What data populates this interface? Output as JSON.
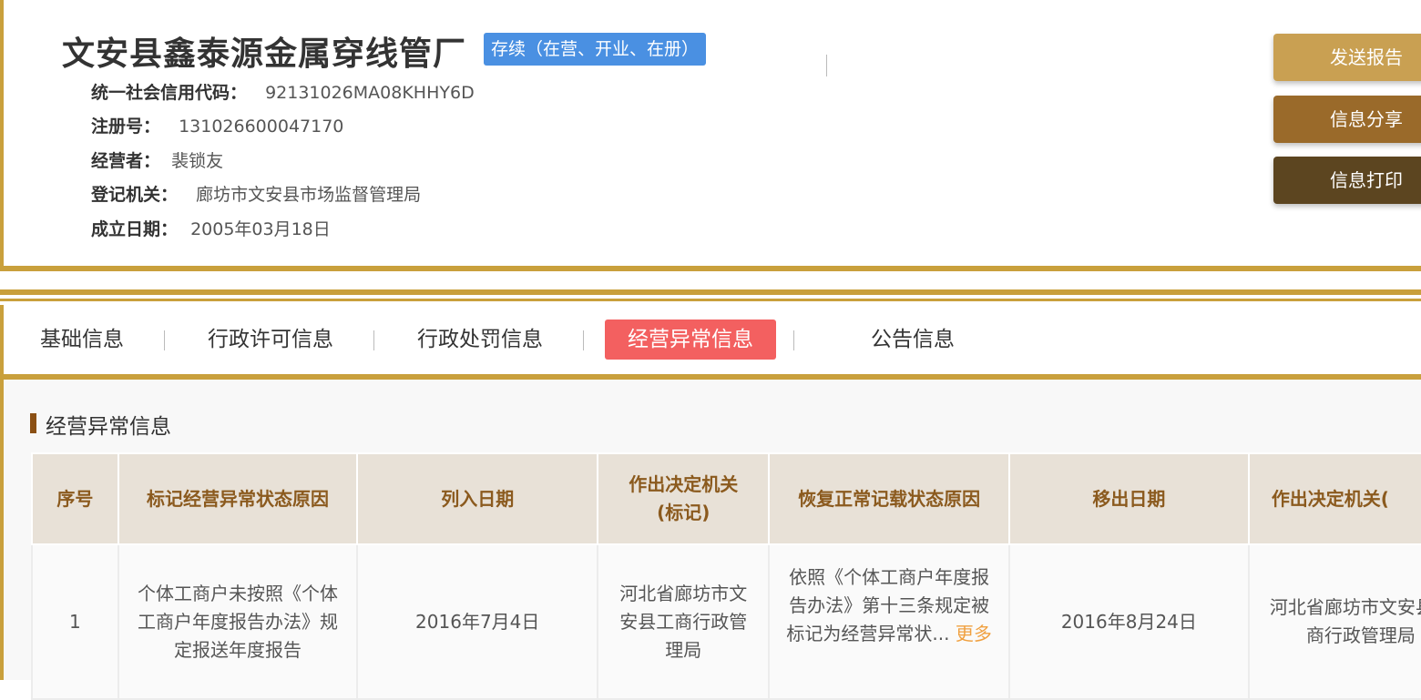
{
  "company": {
    "name": "文安县鑫泰源金属穿线管厂",
    "status": "存续（在营、开业、在册）"
  },
  "info": [
    {
      "label": "统一社会信用代码：",
      "value": "92131026MA08KHHY6D"
    },
    {
      "label": "注册号：",
      "value": "131026600047170"
    },
    {
      "label": "经营者：",
      "value": "裴锁友"
    },
    {
      "label": "登记机关：",
      "value": "廊坊市文安县市场监督管理局"
    },
    {
      "label": "成立日期：",
      "value": "2005年03月18日"
    }
  ],
  "actions": {
    "report": "发送报告",
    "share": "信息分享",
    "print": "信息打印"
  },
  "tabs": [
    "基础信息",
    "行政许可信息",
    "行政处罚信息",
    "经营异常信息",
    "公告信息"
  ],
  "section": {
    "title": "经营异常信息"
  },
  "table": {
    "headers": [
      "序号",
      "标记经营异常状态原因",
      "列入日期",
      "作出决定机关(标记)",
      "恢复正常记载状态原因",
      "移出日期",
      "作出决定机关(移出)"
    ],
    "header_lines": {
      "col4_line1": "作出决定机关",
      "col4_line2": "(标记)",
      "col7_visible": "作出决定机关("
    },
    "rows": [
      {
        "index": "1",
        "reason": "个体工商户未按照《个体工商户年度报告办法》规定报送年度报告",
        "list_date": "2016年7月4日",
        "authority": "河北省廊坊市文安县工商行政管理局",
        "restore_reason": "依照《个体工商户年度报告办法》第十三条规定被标记为经营异常状...",
        "more": "更多",
        "remove_date": "2016年8月24日",
        "remove_authority": "河北省廊坊市文安县工商行政管理局"
      }
    ]
  }
}
